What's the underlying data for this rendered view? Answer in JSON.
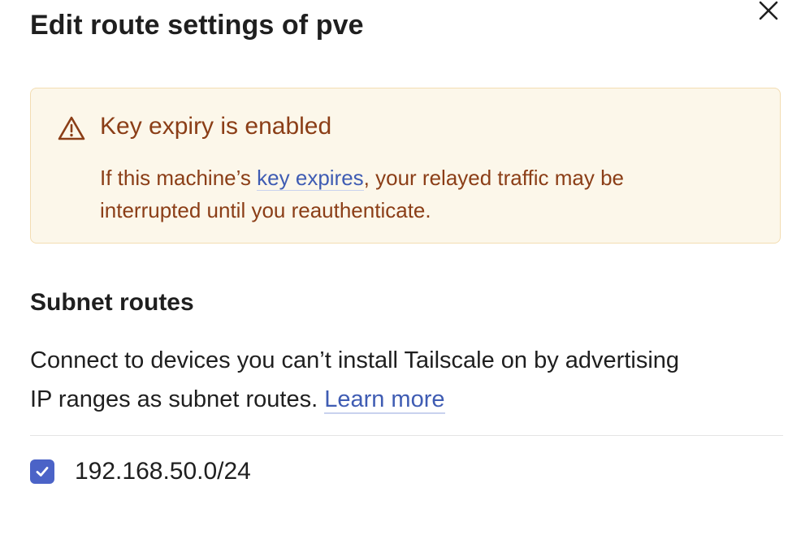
{
  "dialog": {
    "title": "Edit route settings of pve",
    "close_icon": "close-icon"
  },
  "alert": {
    "icon": "warning-icon",
    "title": "Key expiry is enabled",
    "body_prefix": "If this machine’s ",
    "body_link": "key expires",
    "body_suffix": ", your relayed traffic may be",
    "body_line2": "interrupted until you reauthenticate.",
    "colors": {
      "background": "#fcf7ea",
      "border": "#f3ddb2",
      "text": "#8b3e17",
      "link": "#3f5cb3"
    }
  },
  "subnet": {
    "title": "Subnet routes",
    "description_line1": "Connect to devices you can’t install Tailscale on by advertising",
    "description_line2": "IP ranges as subnet routes. ",
    "learn_more": "Learn more",
    "routes": [
      {
        "cidr": "192.168.50.0/24",
        "checked": true
      }
    ]
  },
  "colors": {
    "accent": "#4b63c7",
    "text": "#1f1f1f"
  }
}
